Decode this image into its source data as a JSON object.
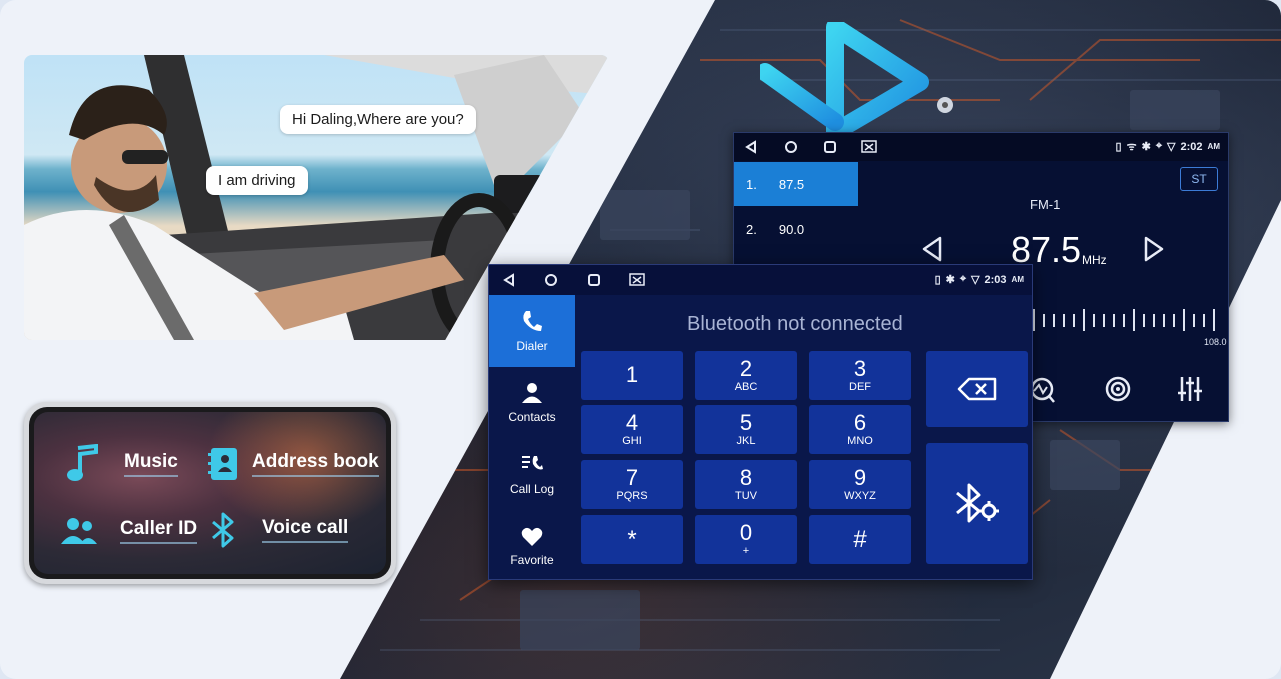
{
  "car_photo": {
    "bubble_question": "Hi Daling,Where are you?",
    "bubble_answer": "I am driving"
  },
  "phone_features": {
    "music": "Music",
    "address_book": "Address book",
    "caller_id": "Caller ID",
    "voice_call": "Voice call"
  },
  "radio": {
    "time": "2:02",
    "ampm": "AM",
    "presets": [
      {
        "num": "1.",
        "freq": "87.5"
      },
      {
        "num": "2.",
        "freq": "90.0"
      }
    ],
    "st_label": "ST",
    "band": "FM-1",
    "frequency": "87.5",
    "unit": "MHz",
    "scale_end": "108.0"
  },
  "dialer": {
    "time": "2:03",
    "ampm": "AM",
    "status_message": "Bluetooth not connected",
    "sidebar": [
      {
        "label": "Dialer"
      },
      {
        "label": "Contacts"
      },
      {
        "label": "Call Log"
      },
      {
        "label": "Favorite"
      }
    ],
    "keys": [
      {
        "digit": "1",
        "letters": ""
      },
      {
        "digit": "2",
        "letters": "ABC"
      },
      {
        "digit": "3",
        "letters": "DEF"
      },
      {
        "digit": "4",
        "letters": "GHI"
      },
      {
        "digit": "5",
        "letters": "JKL"
      },
      {
        "digit": "6",
        "letters": "MNO"
      },
      {
        "digit": "7",
        "letters": "PQRS"
      },
      {
        "digit": "8",
        "letters": "TUV"
      },
      {
        "digit": "9",
        "letters": "WXYZ"
      },
      {
        "digit": "*",
        "letters": ""
      },
      {
        "digit": "0",
        "letters": "+"
      },
      {
        "digit": "#",
        "letters": ""
      }
    ]
  },
  "colors": {
    "accent_blue": "#1c6fd8",
    "key_blue": "#12339a",
    "screen_navy": "#0a174a",
    "icon_cyan": "#3fc9e8"
  }
}
